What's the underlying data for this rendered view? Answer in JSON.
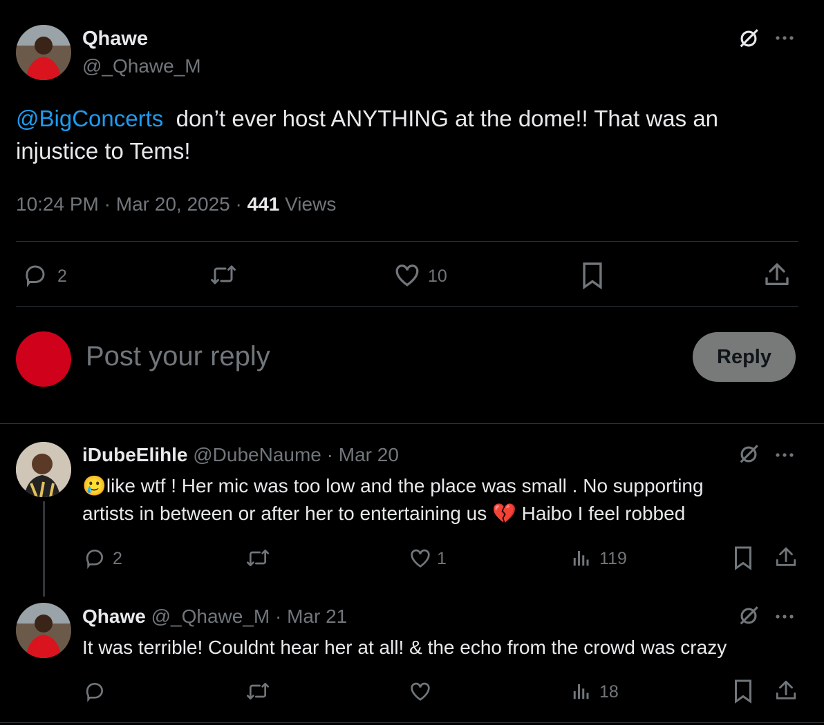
{
  "main_post": {
    "display_name": "Qhawe",
    "handle": "@_Qhawe_M",
    "mention": "@BigConcerts",
    "text_line1": "don’t ever host ANYTHING at the dome!! That was an",
    "text_line2": "injustice to Tems!",
    "time": "10:24 PM",
    "separator": "·",
    "date": "Mar 20, 2025",
    "views_count": "441",
    "views_label": "Views",
    "replies": "2",
    "likes": "10"
  },
  "composer": {
    "placeholder": "Post your reply",
    "reply_label": "Reply",
    "avatar_color": "#d0021b"
  },
  "replies": [
    {
      "display_name": "iDubeElihle",
      "handle": "@DubeNaume",
      "separator": "·",
      "date": "Mar 20",
      "line1_emoji": "🥲",
      "line1": "like wtf ! Her mic was too low and the place was small . No supporting",
      "line2a": "artists in between or after her to entertaining us",
      "line2_emoji": "💔",
      "line2b": "Haibo I feel robbed",
      "replies": "2",
      "likes": "1",
      "views": "119"
    },
    {
      "display_name": "Qhawe",
      "handle": "@_Qhawe_M",
      "separator": "·",
      "date": "Mar 21",
      "text": "It was terrible! Couldnt hear her at all! & the echo from the crowd was crazy",
      "views": "18"
    }
  ],
  "colors": {
    "background": "#000000",
    "text": "#e7e9ea",
    "muted": "#71767b",
    "link": "#1d9bf0",
    "divider": "#2f3336"
  },
  "icons": [
    "grok-icon",
    "more-icon",
    "reply-icon",
    "repost-icon",
    "like-icon",
    "bookmark-icon",
    "share-icon",
    "views-icon"
  ]
}
